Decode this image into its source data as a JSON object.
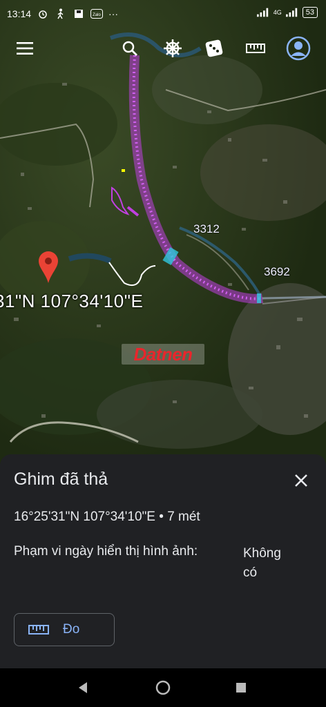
{
  "status_bar": {
    "time": "13:14",
    "network": "4G",
    "battery": "53",
    "more": "···"
  },
  "map": {
    "pin_coordinates_label": "31\"N 107°34'10\"E",
    "road_label_1": "3312",
    "road_label_2": "3692",
    "watermark": "Datnen"
  },
  "toolbar": {
    "menu_icon": "menu-icon",
    "search_icon": "search-icon",
    "voyager_icon": "ship-wheel-icon",
    "feeling_lucky_icon": "dice-icon",
    "measure_icon": "ruler-icon",
    "account_icon": "account-icon"
  },
  "sheet": {
    "title": "Ghim đã thả",
    "coordinates": "16°25'31\"N 107°34'10\"E • 7 mét",
    "imagery_date_label": "Phạm vi ngày hiển thị hình ảnh:",
    "imagery_date_value": "Không có",
    "measure_button_label": "Đo"
  },
  "colors": {
    "sheet_bg": "#202124",
    "accent": "#8ab4f8",
    "pin": "#ea4335",
    "route": "#c040e0"
  }
}
